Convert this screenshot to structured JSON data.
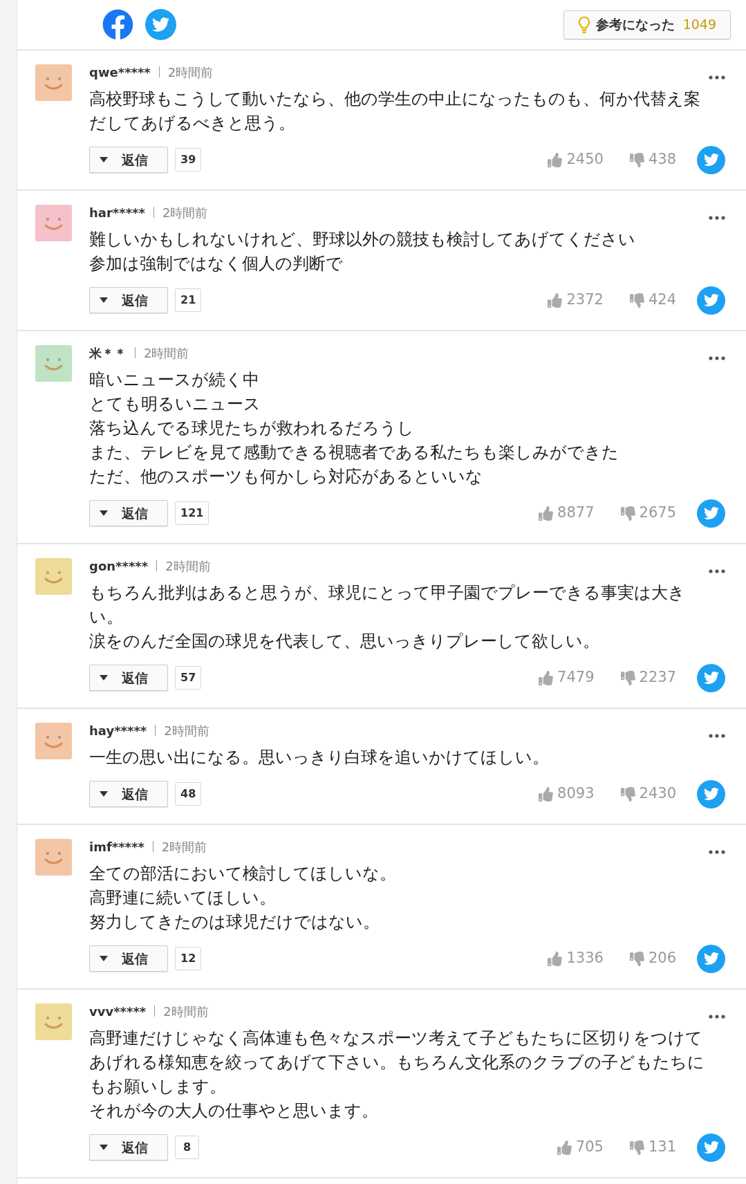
{
  "helpful_button": {
    "label": "参考になった",
    "count": "1049"
  },
  "comments": [
    {
      "color": "#f3c6a6",
      "username": "qwe*****",
      "time": "2時間前",
      "lines": [
        "高校野球もこうして動いたなら、他の学生の中止になったものも、何か代替え案",
        "だしてあげるべきと思う。"
      ],
      "reply_label": "返信",
      "replies": "39",
      "likes": "2450",
      "dislikes": "438"
    },
    {
      "color": "#f4c2c8",
      "username": "har*****",
      "time": "2時間前",
      "lines": [
        "難しいかもしれないけれど、野球以外の競技も検討してあげてください",
        "参加は強制ではなく個人の判断で"
      ],
      "reply_label": "返信",
      "replies": "21",
      "likes": "2372",
      "dislikes": "424"
    },
    {
      "color": "#bfe3c4",
      "username": "米＊＊",
      "time": "2時間前",
      "lines": [
        "暗いニュースが続く中",
        "とても明るいニュース",
        "落ち込んでる球児たちが救われるだろうし",
        "また、テレビを見て感動できる視聴者である私たちも楽しみができた",
        "ただ、他のスポーツも何かしら対応があるといいな"
      ],
      "reply_label": "返信",
      "replies": "121",
      "likes": "8877",
      "dislikes": "2675"
    },
    {
      "color": "#eedc98",
      "username": "gon*****",
      "time": "2時間前",
      "lines": [
        "もちろん批判はあると思うが、球児にとって甲子園でプレーできる事実は大き",
        "い。",
        "涙をのんだ全国の球児を代表して、思いっきりプレーして欲しい。"
      ],
      "reply_label": "返信",
      "replies": "57",
      "likes": "7479",
      "dislikes": "2237"
    },
    {
      "color": "#f3c6a6",
      "username": "hay*****",
      "time": "2時間前",
      "lines": [
        "一生の思い出になる。思いっきり白球を追いかけてほしい。"
      ],
      "reply_label": "返信",
      "replies": "48",
      "likes": "8093",
      "dislikes": "2430"
    },
    {
      "color": "#f3c6a6",
      "username": "imf*****",
      "time": "2時間前",
      "lines": [
        "全ての部活において検討してほしいな。",
        "高野連に続いてほしい。",
        "努力してきたのは球児だけではない。"
      ],
      "reply_label": "返信",
      "replies": "12",
      "likes": "1336",
      "dislikes": "206"
    },
    {
      "color": "#eedc98",
      "username": "vvv*****",
      "time": "2時間前",
      "lines": [
        "高野連だけじゃなく高体連も色々なスポーツ考えて子どもたちに区切りをつけて",
        "あげれる様知恵を絞ってあげて下さい。もちろん文化系のクラブの子どもたちに",
        "もお願いします。",
        "それが今の大人の仕事やと思います。"
      ],
      "reply_label": "返信",
      "replies": "8",
      "likes": "705",
      "dislikes": "131"
    }
  ]
}
